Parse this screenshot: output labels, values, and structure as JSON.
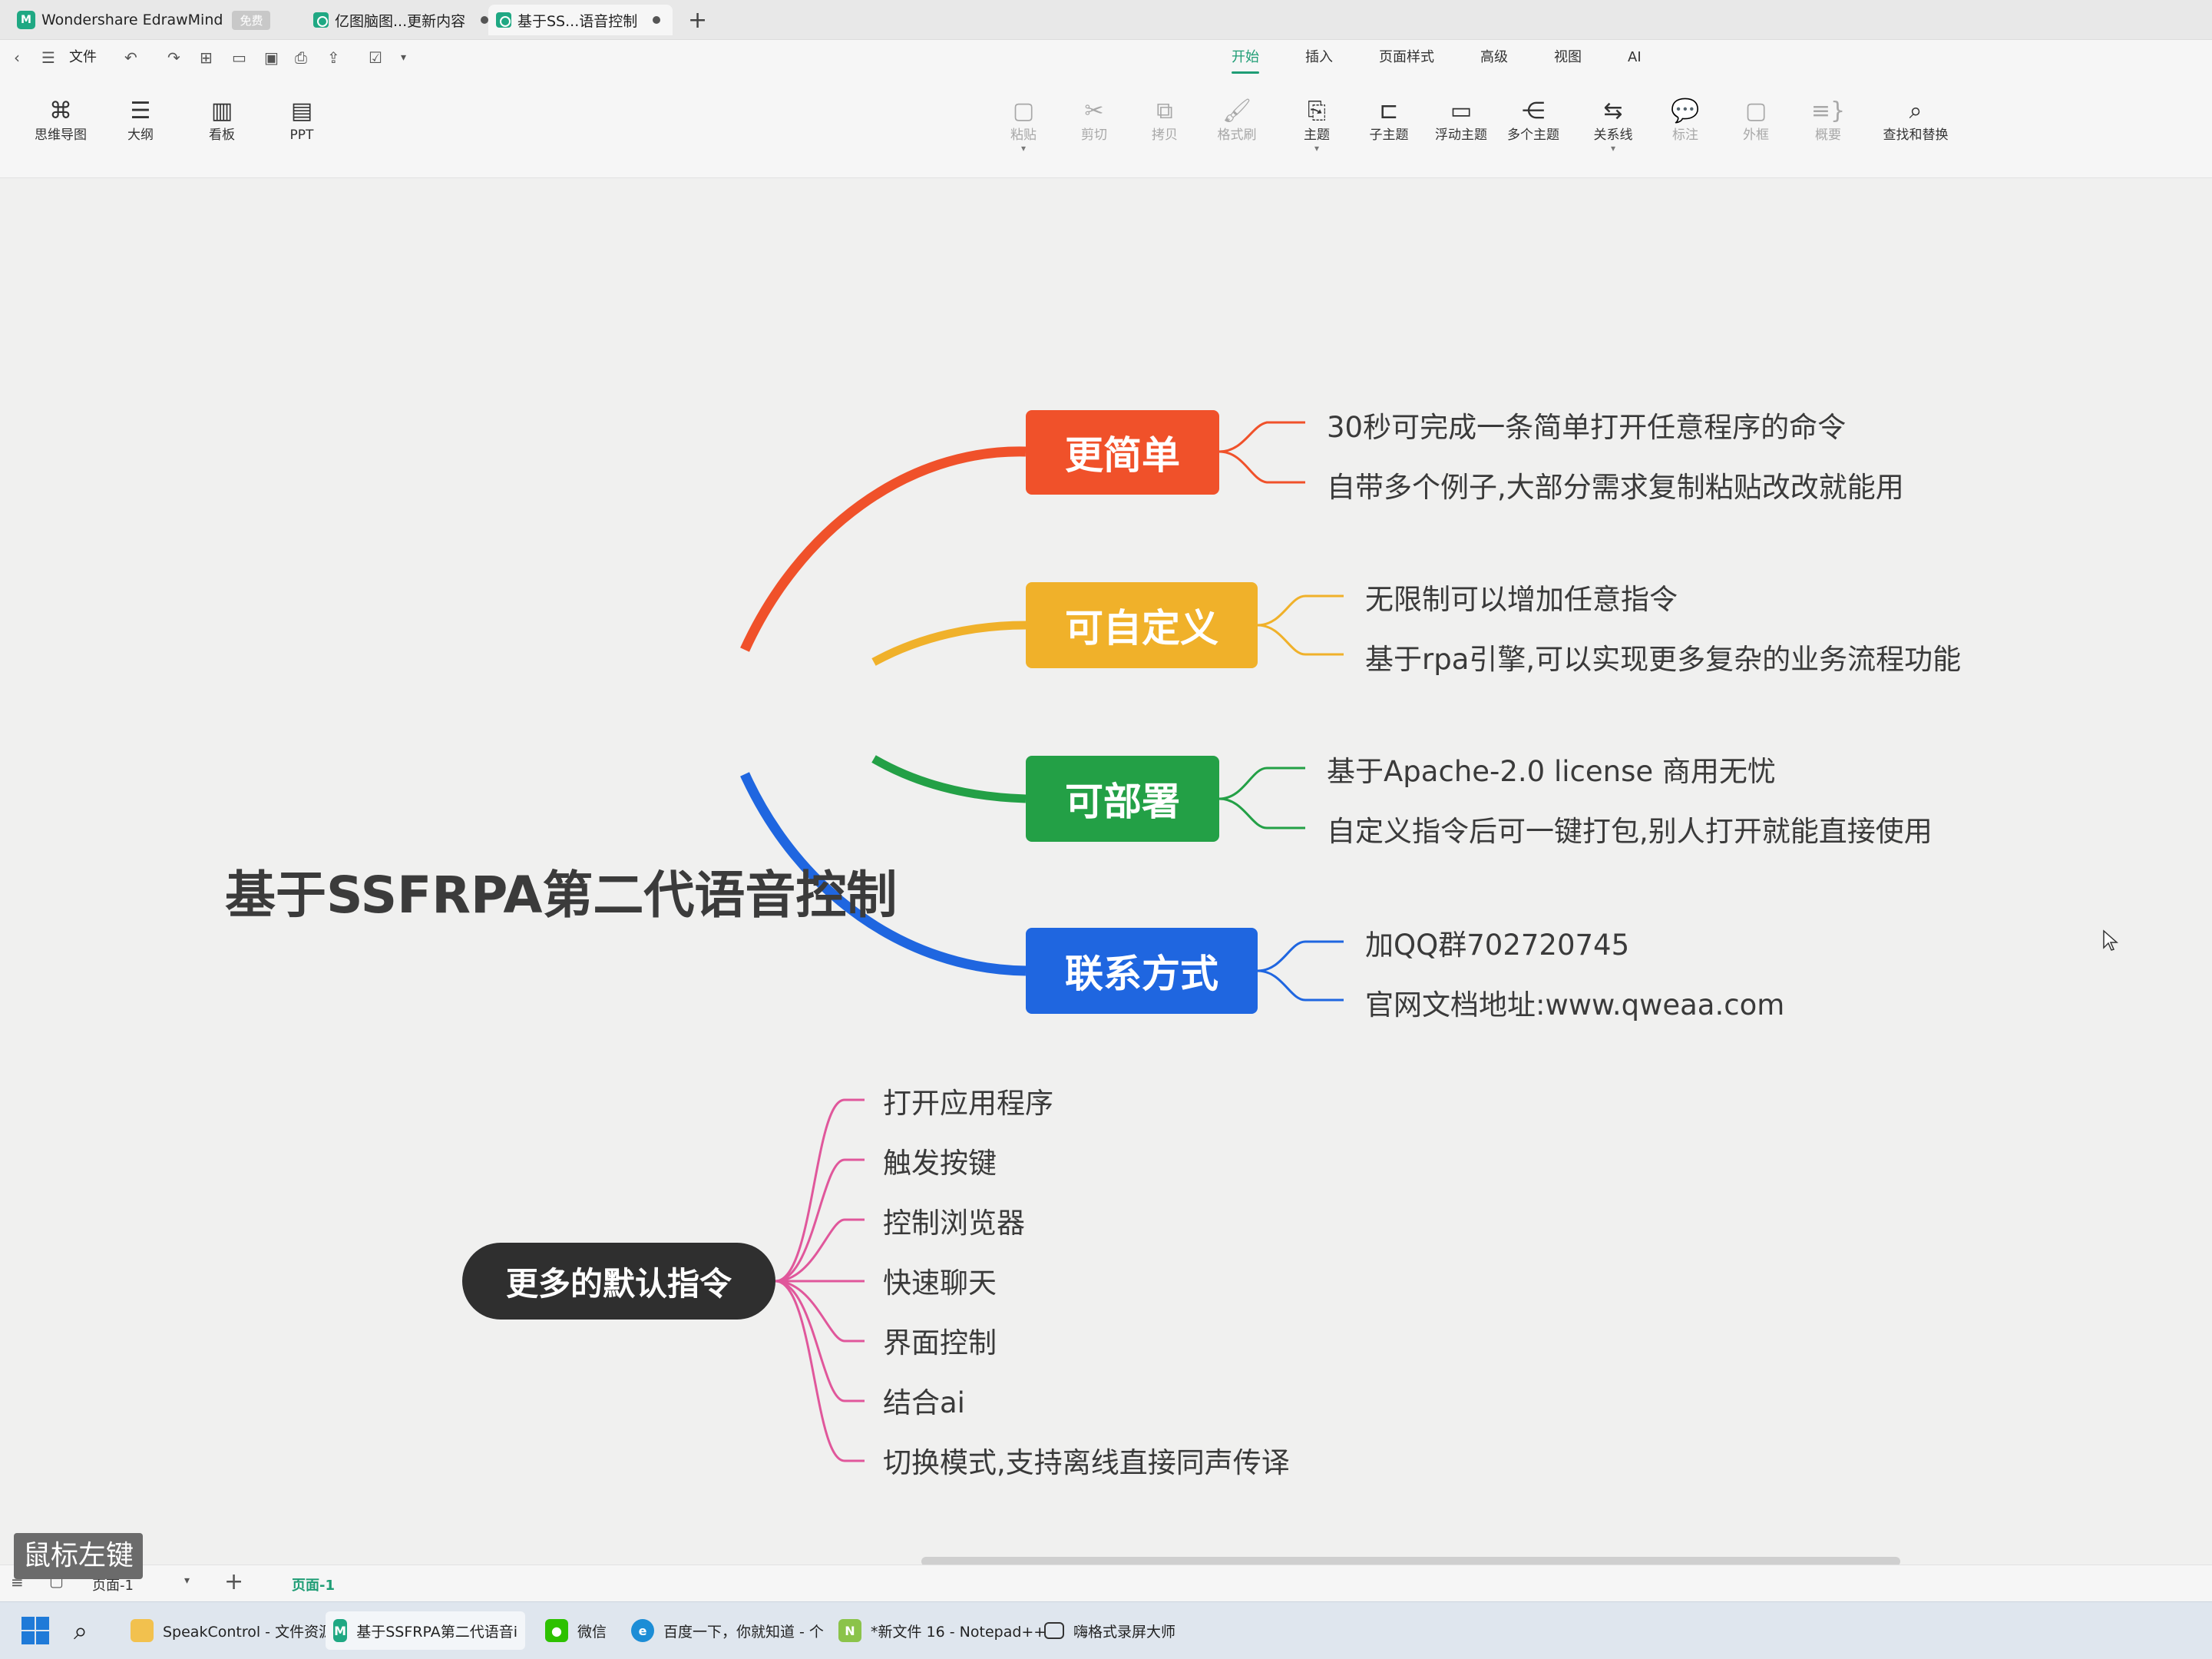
{
  "app": {
    "tabs": [
      {
        "label": "Wondershare EdrawMind",
        "badge": "免费"
      },
      {
        "label": "亿图脑图...更新内容"
      },
      {
        "label": "基于SS...语音控制"
      }
    ],
    "file_menu": "文件"
  },
  "menu": {
    "tabs": [
      "开始",
      "插入",
      "页面样式",
      "高级",
      "视图",
      "AI"
    ],
    "selected": "开始"
  },
  "views": [
    "思维导图",
    "大纲",
    "看板",
    "PPT"
  ],
  "ribbon": {
    "paste": "粘贴",
    "cut": "剪切",
    "copy": "拷贝",
    "format_painter": "格式刷",
    "topic": "主题",
    "subtopic": "子主题",
    "floating": "浮动主题",
    "multiple": "多个主题",
    "relation": "关系线",
    "callout": "标注",
    "boundary": "外框",
    "summary": "概要",
    "find_replace": "查找和替换"
  },
  "mindmap": {
    "central": "基于SSFRPA第二代语音控制",
    "branches": [
      {
        "label": "更简单",
        "color": "#f0512a",
        "items": [
          "30秒可完成一条简单打开任意程序的命令",
          "自带多个例子,大部分需求复制粘贴改改就能用"
        ]
      },
      {
        "label": "可自定义",
        "color": "#f0b12a",
        "items": [
          "无限制可以增加任意指令",
          "基于rpa引擎,可以实现更多复杂的业务流程功能"
        ]
      },
      {
        "label": "可部署",
        "color": "#23a046",
        "items": [
          "基于Apache-2.0 license 商用无忧",
          "自定义指令后可一键打包,别人打开就能直接使用"
        ]
      },
      {
        "label": "联系方式",
        "color": "#1f66e0",
        "items": [
          "加QQ群702720745",
          "官网文档地址:www.qweaa.com"
        ]
      }
    ],
    "floating": {
      "label": "更多的默认指令",
      "color": "#2f2f2f",
      "line_color": "#e0579b",
      "items": [
        "打开应用程序",
        "触发按键",
        "控制浏览器",
        "快速聊天",
        "界面控制",
        "结合ai",
        "切换模式,支持离线直接同声传译"
      ]
    }
  },
  "pagebar": {
    "page_select": "页面-1",
    "page_tab": "页面-1"
  },
  "overlay": {
    "mouse_hint": "鼠标左键"
  },
  "taskbar": [
    {
      "label": "SpeakControl - 文件资源",
      "icon": "folder-icon"
    },
    {
      "label": "基于SSFRPA第二代语音i",
      "icon": "edrawmind-icon"
    },
    {
      "label": "微信",
      "icon": "wechat-icon"
    },
    {
      "label": "百度一下，你就知道 - 个",
      "icon": "edge-icon"
    },
    {
      "label": "*新文件 16 - Notepad++",
      "icon": "notepad-icon"
    },
    {
      "label": "嗨格式录屏大师",
      "icon": "recorder-icon"
    }
  ]
}
